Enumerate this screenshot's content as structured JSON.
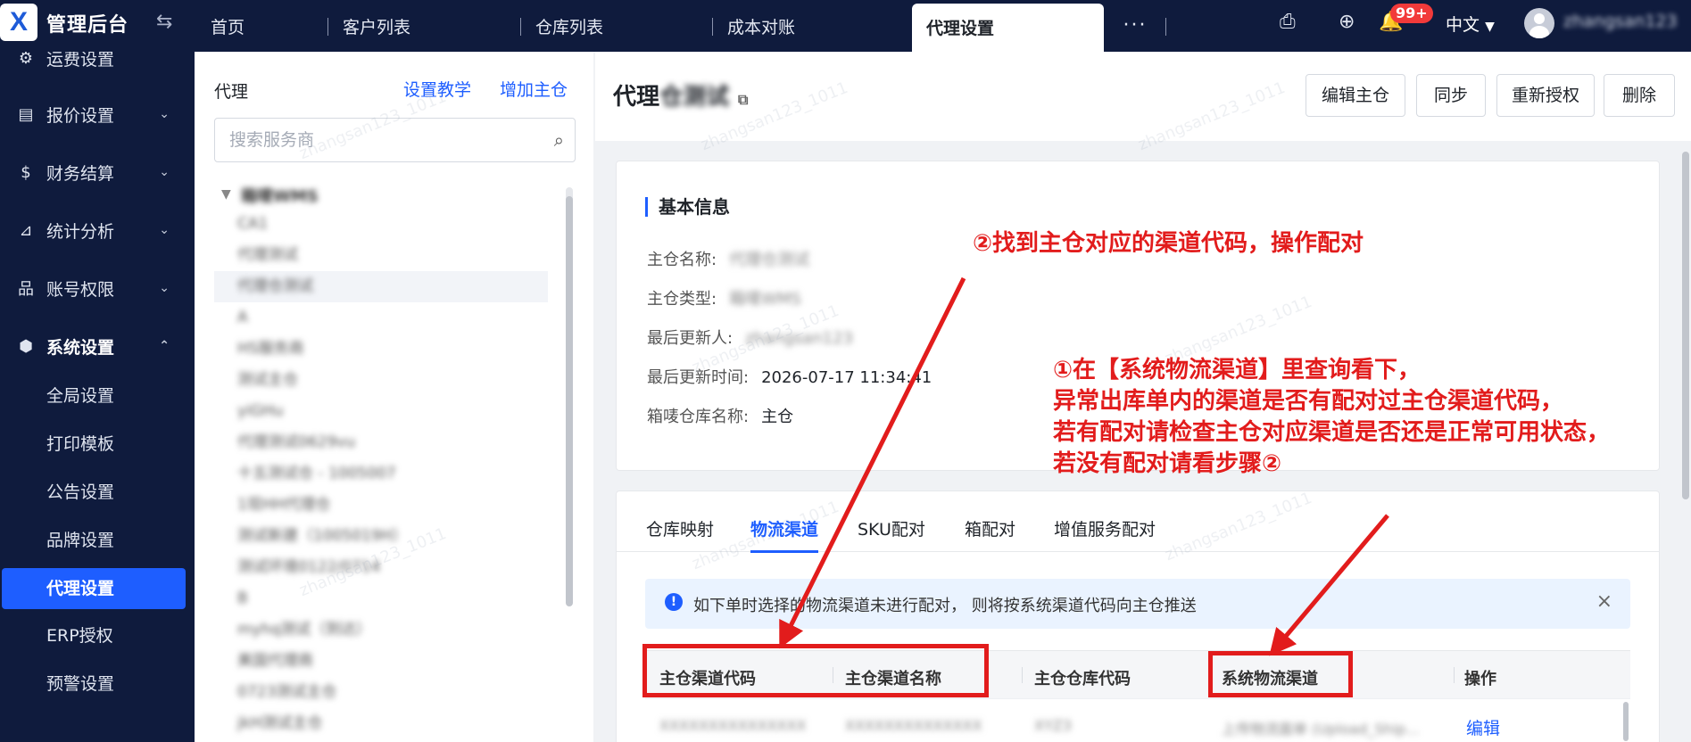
{
  "header": {
    "logo_text": "X",
    "app_title": "管理后台",
    "tabs": [
      {
        "label": "首页"
      },
      {
        "label": "客户列表"
      },
      {
        "label": "仓库列表"
      },
      {
        "label": "成本对账"
      },
      {
        "label": "代理设置"
      }
    ],
    "more_label": "···",
    "notification_badge": "99+",
    "language": "中文",
    "username": "zhangsan123"
  },
  "sidebar": {
    "top_partial": "运费设置",
    "groups": [
      {
        "label": "报价设置",
        "icon": "doc-icon"
      },
      {
        "label": "财务结算",
        "icon": "money-icon"
      },
      {
        "label": "统计分析",
        "icon": "chart-icon"
      },
      {
        "label": "账号权限",
        "icon": "org-icon"
      },
      {
        "label": "系统设置",
        "icon": "hexagon-icon"
      }
    ],
    "sub_items": [
      "全局设置",
      "打印模板",
      "公告设置",
      "品牌设置",
      "代理设置",
      "ERP授权",
      "预警设置"
    ],
    "active_sub": "代理设置"
  },
  "agent_list": {
    "title": "代理",
    "link_tutorial": "设置教学",
    "link_add": "增加主仓",
    "search_placeholder": "搜索服务商",
    "tree_root": "箱唛WMS",
    "items": [
      "CA1",
      "代理测试",
      "代理仓测试",
      "A",
      "HS服务商",
      "测试主仓",
      "yiGHu",
      "代理测试0629vu",
      "十五测试仓 - 1005007",
      "1现HH代理仓",
      "测试新建（1005019H）",
      "测试环境0122/0714",
      "B",
      "myhq测试（到达）",
      "美国代理商",
      "0723测试主仓",
      "jkH测试主仓"
    ],
    "selected_index": 2
  },
  "detail": {
    "title_prefix": "代理",
    "title_blurred": "仓测试",
    "buttons": {
      "edit": "编辑主仓",
      "sync": "同步",
      "reauth": "重新授权",
      "delete": "删除"
    },
    "basic_info": {
      "title": "基本信息",
      "fields": [
        {
          "label": "主仓名称:",
          "value": "代理仓测试"
        },
        {
          "label": "主仓类型:",
          "value": "箱唛WMS"
        },
        {
          "label": "最后更新人:",
          "value": "zhangsan123"
        },
        {
          "label": "最后更新时间:",
          "value": "2026-07-17 11:34:41"
        },
        {
          "label": "箱唛仓库名称:",
          "value": "主仓"
        }
      ]
    },
    "sub_tabs": [
      "仓库映射",
      "物流渠道",
      "SKU配对",
      "箱配对",
      "增值服务配对"
    ],
    "active_sub_tab": "物流渠道",
    "alert_text": "如下单时选择的物流渠道未进行配对， 则将按系统渠道代码向主仓推送",
    "table": {
      "columns": [
        "主仓渠道代码",
        "主仓渠道名称",
        "主仓仓库代码",
        "系统物流渠道",
        "操作"
      ],
      "rows": [
        {
          "code": "XXXXXXXXXXXXXXX",
          "name": "XXXXXXXXXXXXXX",
          "warehouse": "XYZ3",
          "system_channel": "上传物流面单 (Upload_Ship...",
          "action": "编辑"
        }
      ]
    }
  },
  "annotations": {
    "note1_lines": [
      "①在【系统物流渠道】里查询看下，",
      "异常出库单内的渠道是否有配对过主仓渠道代码，",
      "若有配对请检查主仓对应渠道是否还是正常可用状态，",
      "若没有配对请看步骤②"
    ],
    "note2": "②找到主仓对应的渠道代码，操作配对",
    "color": "#e21c1c"
  },
  "watermark": "zhangsan123_1011",
  "colors": {
    "nav_bg": "#0f1b3d",
    "accent": "#1e5eff",
    "annotation": "#e21c1c"
  }
}
